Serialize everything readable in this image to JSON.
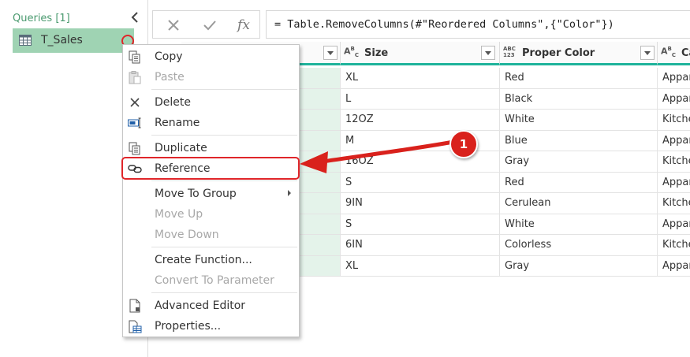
{
  "queries_pane": {
    "header": "Queries [1]",
    "query": {
      "name": "T_Sales",
      "icon": "table-icon"
    },
    "collapse_icon": "chevron-left-icon"
  },
  "formula_bar": {
    "cancel_icon": "close-icon",
    "commit_icon": "check-icon",
    "fx_label": "fx",
    "formula": "= Table.RemoveColumns(#\"Reordered Columns\",{\"Color\"})"
  },
  "grid": {
    "columns": [
      {
        "name": "",
        "type": ""
      },
      {
        "name": "Size",
        "type": "ABC"
      },
      {
        "name": "Proper Color",
        "type": "ABC123"
      },
      {
        "name": "Ca",
        "type": "ABC"
      }
    ],
    "rows": [
      [
        "",
        "XL",
        "Red",
        "Appar"
      ],
      [
        "",
        "L",
        "Black",
        "Appar"
      ],
      [
        "",
        "12OZ",
        "White",
        "Kitche"
      ],
      [
        "",
        "M",
        "Blue",
        "Appar"
      ],
      [
        "",
        "16OZ",
        "Gray",
        "Kitche"
      ],
      [
        "",
        "S",
        "Red",
        "Appar"
      ],
      [
        "",
        "9IN",
        "Cerulean",
        "Kitche"
      ],
      [
        "",
        "S",
        "White",
        "Appar"
      ],
      [
        "",
        "6IN",
        "Colorless",
        "Kitche"
      ],
      [
        "",
        "XL",
        "Gray",
        "Appar"
      ]
    ]
  },
  "context_menu": {
    "items": [
      {
        "label": "Copy",
        "icon": "copy-icon",
        "disabled": false
      },
      {
        "label": "Paste",
        "icon": "paste-icon",
        "disabled": true
      },
      {
        "label": "Delete",
        "icon": "delete-icon",
        "disabled": false
      },
      {
        "label": "Rename",
        "icon": "rename-icon",
        "disabled": false
      },
      {
        "label": "Duplicate",
        "icon": "duplicate-icon",
        "disabled": false
      },
      {
        "label": "Reference",
        "icon": "link-icon",
        "disabled": false
      },
      {
        "label": "Move To Group",
        "icon": "",
        "disabled": false
      },
      {
        "label": "Move Up",
        "icon": "",
        "disabled": true
      },
      {
        "label": "Move Down",
        "icon": "",
        "disabled": true
      },
      {
        "label": "Create Function...",
        "icon": "",
        "disabled": false
      },
      {
        "label": "Convert To Parameter",
        "icon": "",
        "disabled": true
      },
      {
        "label": "Advanced Editor",
        "icon": "document-icon",
        "disabled": false
      },
      {
        "label": "Properties...",
        "icon": "properties-icon",
        "disabled": false
      }
    ]
  },
  "callout": {
    "number": "1"
  },
  "colors": {
    "accent_green": "#9fd3b3",
    "header_underline": "#1fb39b",
    "callout_red": "#d9211c",
    "disabled_text": "#a8a8a8"
  }
}
